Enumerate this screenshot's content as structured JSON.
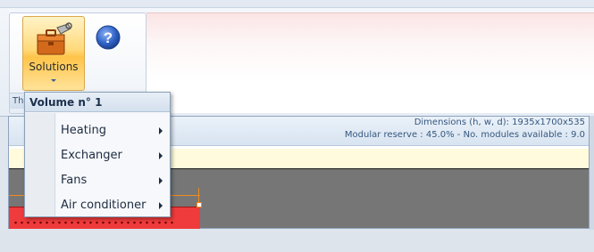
{
  "ribbon": {
    "group_caption": "Th",
    "solutions_button": {
      "label": "Solutions",
      "icon": "toolbox-icon"
    },
    "help_button": {
      "icon": "help-icon",
      "accent": "#2f62c7"
    }
  },
  "dropdown": {
    "header": "Volume n° 1",
    "items": [
      {
        "label": "Heating"
      },
      {
        "label": "Exchanger"
      },
      {
        "label": "Fans"
      },
      {
        "label": "Air conditioner"
      }
    ]
  },
  "info": {
    "dimensions": "Dimensions (h, w, d): 1935x1700x535",
    "modular": "Modular reserve : 45.0% - No. modules available : 9.0"
  },
  "colors": {
    "unit_red": "#ef3b3b",
    "dimension_orange": "#f08a1c",
    "drawing_gray": "#767676",
    "band_yellow": "#fffbdc"
  }
}
